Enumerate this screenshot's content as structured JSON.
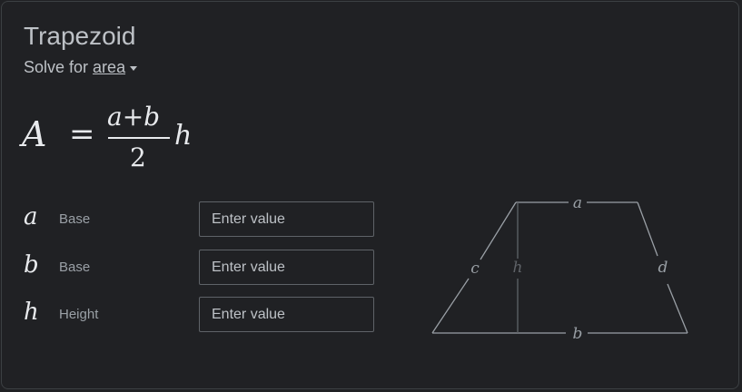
{
  "card": {
    "title": "Trapezoid",
    "solve_prefix": "Solve for",
    "solve_target": "area"
  },
  "formula": {
    "lhs": "A",
    "eq": "=",
    "numerator": "a+b",
    "denominator": "2",
    "factor": "h"
  },
  "inputs": [
    {
      "symbol": "a",
      "label": "Base",
      "placeholder": "Enter value"
    },
    {
      "symbol": "b",
      "label": "Base",
      "placeholder": "Enter value"
    },
    {
      "symbol": "h",
      "label": "Height",
      "placeholder": "Enter value"
    }
  ],
  "diagram": {
    "labels": {
      "a": "a",
      "b": "b",
      "c": "c",
      "d": "d",
      "h": "h"
    },
    "line_color": "#9aa0a6",
    "height_color": "#5f6368"
  },
  "colors": {
    "background": "#202124",
    "text": "#bdc1c6",
    "label": "#9aa0a6",
    "border": "#5f6368"
  }
}
